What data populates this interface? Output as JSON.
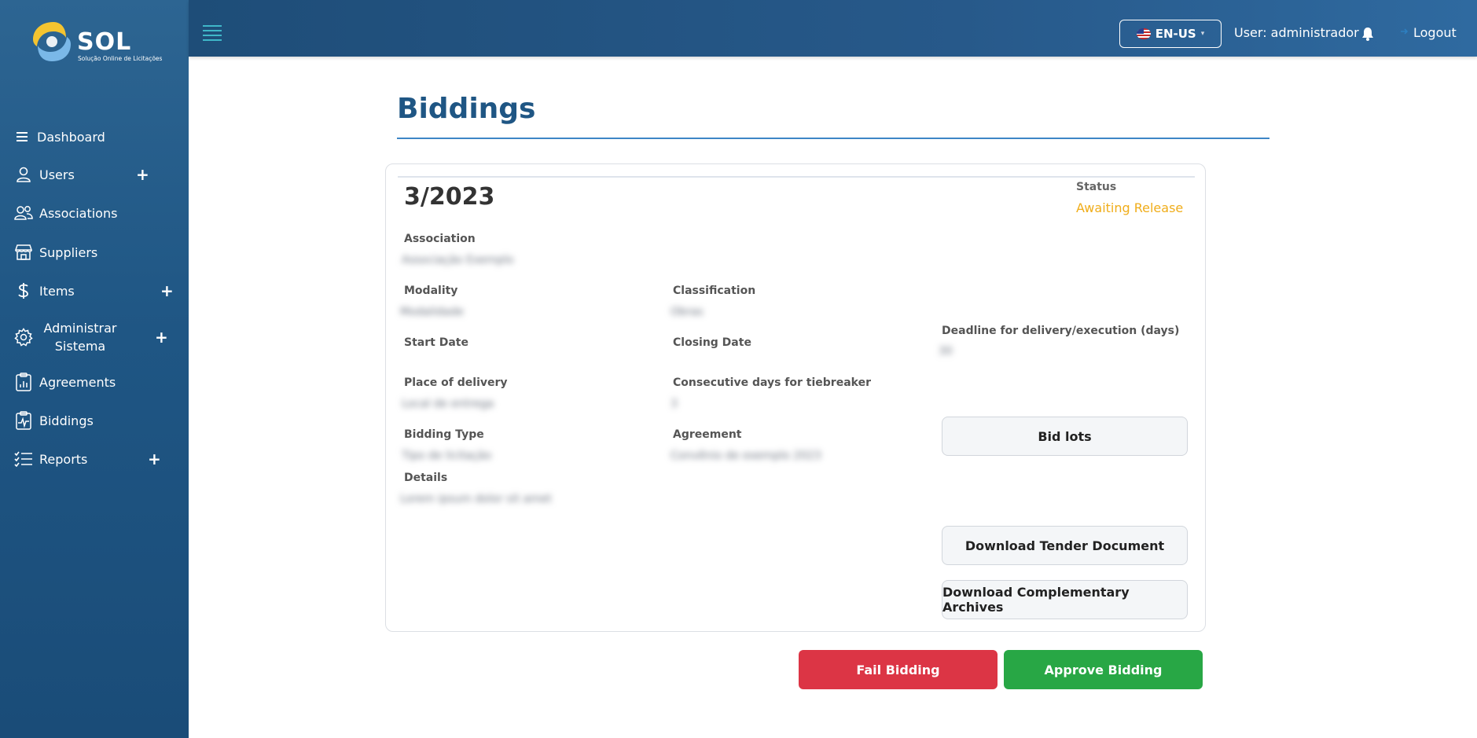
{
  "app": {
    "logo_text": "SOL",
    "logo_subtitle": "Solução Online de Licitações"
  },
  "sidebar": {
    "items": [
      {
        "label": "Dashboard",
        "icon": "menu-lines-icon",
        "expandable": false
      },
      {
        "label": "Users",
        "icon": "user-icon",
        "expandable": true
      },
      {
        "label": "Associations",
        "icon": "users-group-icon",
        "expandable": false
      },
      {
        "label": "Suppliers",
        "icon": "store-icon",
        "expandable": false
      },
      {
        "label": "Items",
        "icon": "dollar-icon",
        "expandable": true
      },
      {
        "label": "Administrar Sistema",
        "icon": "gear-icon",
        "expandable": true
      },
      {
        "label": "Agreements",
        "icon": "clipboard-chart-icon",
        "expandable": false
      },
      {
        "label": "Biddings",
        "icon": "clipboard-pulse-icon",
        "expandable": false
      },
      {
        "label": "Reports",
        "icon": "list-check-icon",
        "expandable": true
      }
    ],
    "plus_symbol": "+"
  },
  "header": {
    "language": "EN-US",
    "user": "User: administrador",
    "logout": "Logout"
  },
  "page": {
    "title": "Biddings"
  },
  "bidding": {
    "number": "3/2023",
    "status_label": "Status",
    "status_value": "Awaiting Release",
    "status_color": "#f0ad1a",
    "fields": {
      "association_label": "Association",
      "association_value": "Associação Exemplo",
      "modality_label": "Modality",
      "modality_value": "Modalidade",
      "classification_label": "Classification",
      "classification_value": "Obras",
      "deadline_label": "Deadline for delivery/execution (days)",
      "deadline_value": "30",
      "start_date_label": "Start Date",
      "closing_date_label": "Closing Date",
      "place_label": "Place of delivery",
      "place_value": "Local de entrega",
      "tiebreaker_label": "Consecutive days for tiebreaker",
      "tiebreaker_value": "3",
      "bidding_type_label": "Bidding Type",
      "bidding_type_value": "Tipo de licitação",
      "agreement_label": "Agreement",
      "agreement_value": "Convênio de exemplo 2023",
      "details_label": "Details",
      "details_value": "Lorem ipsum dolor sit amet"
    },
    "buttons": {
      "bid_lots": "Bid lots",
      "download_tender": "Download Tender Document",
      "download_complementary": "Download Complementary Archives"
    }
  },
  "actions": {
    "fail": "Fail Bidding",
    "approve": "Approve Bidding",
    "fail_color": "#dc3545",
    "approve_color": "#28a745"
  }
}
